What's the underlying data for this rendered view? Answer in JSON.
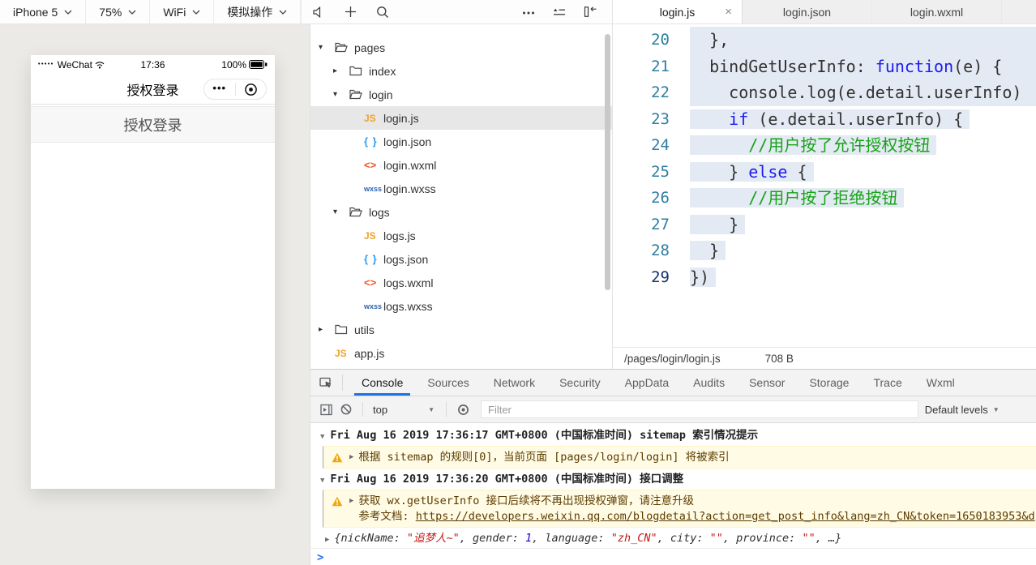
{
  "colors": {
    "accent_blue": "#1a73e8",
    "warning_bg": "#fffbe5",
    "selection_bg": "#e4eaf3",
    "keyword_blue": "#1b1bf0",
    "comment_green": "#17a317",
    "string_red": "#c41a16",
    "number_blue": "#1c00cf",
    "js_icon_orange": "#f0a228"
  },
  "toolbar": {
    "dropdowns": [
      {
        "label": "iPhone 5"
      },
      {
        "label": "75%"
      },
      {
        "label": "WiFi"
      },
      {
        "label": "模拟操作"
      }
    ]
  },
  "editor_tabs": [
    {
      "label": "login.js",
      "active": true,
      "closable": true
    },
    {
      "label": "login.json",
      "active": false
    },
    {
      "label": "login.wxml",
      "active": false
    }
  ],
  "simulator": {
    "status_bar": {
      "carrier": "WeChat",
      "time": "17:36",
      "battery": "100%",
      "signal_dots": "•••••"
    },
    "nav_title": "授权登录",
    "menu_dots": "•••",
    "auth_button": "授权登录"
  },
  "file_tree": {
    "items": [
      {
        "label": "pages",
        "type": "folder",
        "expanded": true,
        "level": 0
      },
      {
        "label": "index",
        "type": "folder",
        "expanded": false,
        "level": 1
      },
      {
        "label": "login",
        "type": "folder",
        "expanded": true,
        "level": 1
      },
      {
        "label": "login.js",
        "type": "js",
        "level": 2,
        "selected": true
      },
      {
        "label": "login.json",
        "type": "json",
        "level": 2
      },
      {
        "label": "login.wxml",
        "type": "wxml",
        "level": 2
      },
      {
        "label": "login.wxss",
        "type": "wxss",
        "level": 2
      },
      {
        "label": "logs",
        "type": "folder",
        "expanded": true,
        "level": 1
      },
      {
        "label": "logs.js",
        "type": "js",
        "level": 2
      },
      {
        "label": "logs.json",
        "type": "json",
        "level": 2
      },
      {
        "label": "logs.wxml",
        "type": "wxml",
        "level": 2
      },
      {
        "label": "logs.wxss",
        "type": "wxss",
        "level": 2
      },
      {
        "label": "utils",
        "type": "folder",
        "expanded": false,
        "level": 0
      },
      {
        "label": "app.js",
        "type": "js",
        "level": 0
      }
    ]
  },
  "editor": {
    "lines": [
      {
        "num": 20,
        "full": true,
        "tokens": [
          {
            "t": "  },"
          }
        ]
      },
      {
        "num": 21,
        "full": true,
        "tokens": [
          {
            "t": "  bindGetUserInfo: "
          },
          {
            "t": "function",
            "c": "kw"
          },
          {
            "t": "(e) {"
          }
        ]
      },
      {
        "num": 22,
        "full": true,
        "tokens": [
          {
            "t": "    console.log(e.detail.userInfo)"
          }
        ]
      },
      {
        "num": 23,
        "tokens": [
          {
            "t": "    "
          },
          {
            "t": "if",
            "c": "kw"
          },
          {
            "t": " (e.detail.userInfo) {"
          }
        ]
      },
      {
        "num": 24,
        "tokens": [
          {
            "t": "      "
          },
          {
            "t": "//用户按了允许授权按钮",
            "c": "com"
          }
        ]
      },
      {
        "num": 25,
        "tokens": [
          {
            "t": "    } "
          },
          {
            "t": "else",
            "c": "kw"
          },
          {
            "t": " {"
          }
        ]
      },
      {
        "num": 26,
        "tokens": [
          {
            "t": "      "
          },
          {
            "t": "//用户按了拒绝按钮",
            "c": "com"
          }
        ]
      },
      {
        "num": 27,
        "tokens": [
          {
            "t": "    }"
          }
        ]
      },
      {
        "num": 28,
        "tokens": [
          {
            "t": "  }"
          }
        ]
      },
      {
        "num": 29,
        "current": true,
        "tokens": [
          {
            "t": "})"
          }
        ]
      }
    ],
    "status": {
      "path": "/pages/login/login.js",
      "size": "708 B"
    }
  },
  "debugger": {
    "tabs": [
      {
        "label": "Console",
        "active": true
      },
      {
        "label": "Sources"
      },
      {
        "label": "Network"
      },
      {
        "label": "Security"
      },
      {
        "label": "AppData"
      },
      {
        "label": "Audits"
      },
      {
        "label": "Sensor"
      },
      {
        "label": "Storage"
      },
      {
        "label": "Trace"
      },
      {
        "label": "Wxml"
      }
    ],
    "toolbar": {
      "context": "top",
      "filter_placeholder": "Filter",
      "levels": "Default levels"
    },
    "messages": [
      {
        "kind": "group",
        "text": "Fri Aug 16 2019 17:36:17 GMT+0800 (中国标准时间) sitemap 索引情况提示"
      },
      {
        "kind": "warning",
        "lines": [
          [
            {
              "t": "根据 sitemap 的规则[0]，当前页面 [pages/login/login] 将被索引"
            }
          ]
        ]
      },
      {
        "kind": "group",
        "text": "Fri Aug 16 2019 17:36:20 GMT+0800 (中国标准时间) 接口调整"
      },
      {
        "kind": "warning",
        "lines": [
          [
            {
              "t": "获取 wx.getUserInfo 接口后续将不再出现授权弹窗，请注意升级"
            }
          ],
          [
            {
              "t": "参考文档: "
            },
            {
              "t": "https://developers.weixin.qq.com/blogdetail?action=get_post_info&lang=zh_CN&token=1650183953&d",
              "c": "link"
            }
          ]
        ]
      },
      {
        "kind": "object",
        "segments": [
          {
            "t": "{nickName: "
          },
          {
            "t": "\"追梦人~\"",
            "c": "str"
          },
          {
            "t": ", gender: "
          },
          {
            "t": "1",
            "c": "num"
          },
          {
            "t": ", language: "
          },
          {
            "t": "\"zh_CN\"",
            "c": "str"
          },
          {
            "t": ", city: "
          },
          {
            "t": "\"\"",
            "c": "str"
          },
          {
            "t": ", province: "
          },
          {
            "t": "\"\"",
            "c": "str"
          },
          {
            "t": ", …}"
          }
        ]
      },
      {
        "kind": "prompt"
      }
    ]
  }
}
